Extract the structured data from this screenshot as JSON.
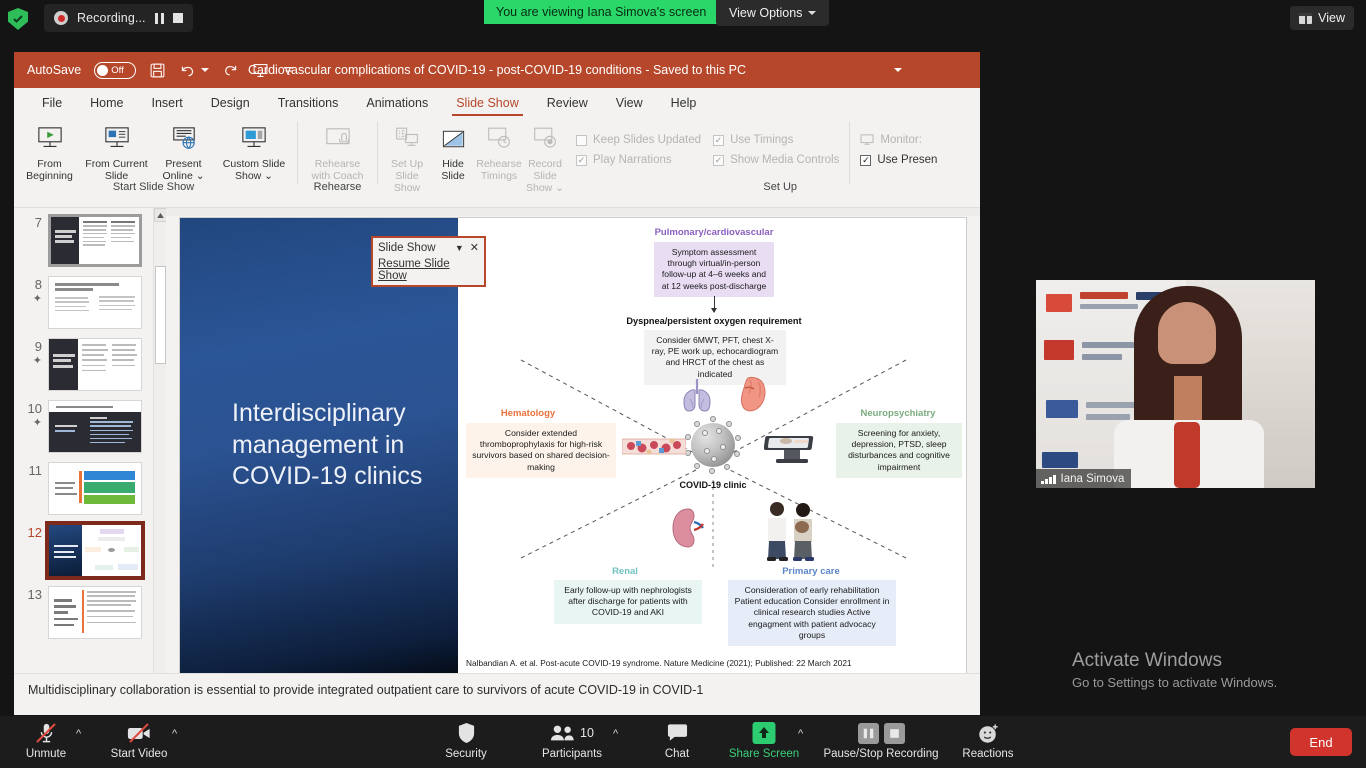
{
  "zoom_top": {
    "recording_label": "Recording...",
    "viewing_banner": "You are viewing Iana Simova's screen",
    "view_options": "View Options",
    "view_button": "View"
  },
  "powerpoint": {
    "autosave_label": "AutoSave",
    "autosave_state": "Off",
    "document_title": "Cardiovascular complications of COVID-19 - post-COVID-19 conditions  -  Saved to this PC",
    "quick_access": [
      "save-icon",
      "undo-icon",
      "redo-icon",
      "start-slideshow-icon",
      "more-icon"
    ],
    "tabs": [
      {
        "label": "File",
        "active": false
      },
      {
        "label": "Home",
        "active": false
      },
      {
        "label": "Insert",
        "active": false
      },
      {
        "label": "Design",
        "active": false
      },
      {
        "label": "Transitions",
        "active": false
      },
      {
        "label": "Animations",
        "active": false
      },
      {
        "label": "Slide Show",
        "active": true
      },
      {
        "label": "Review",
        "active": false
      },
      {
        "label": "View",
        "active": false
      },
      {
        "label": "Help",
        "active": false
      }
    ],
    "ribbon": {
      "groups": [
        {
          "label": "Start Slide Show",
          "buttons": [
            {
              "label": "From Beginning",
              "icon": "from-beginning-icon",
              "disabled": false
            },
            {
              "label": "From Current Slide",
              "icon": "from-current-slide-icon",
              "disabled": false
            },
            {
              "label": "Present Online ⌄",
              "icon": "present-online-icon",
              "disabled": false
            },
            {
              "label": "Custom Slide Show ⌄",
              "icon": "custom-slide-show-icon",
              "disabled": false
            }
          ]
        },
        {
          "label": "Rehearse",
          "buttons": [
            {
              "label": "Rehearse with Coach",
              "icon": "rehearse-with-coach-icon",
              "disabled": true
            }
          ]
        },
        {
          "label": "",
          "buttons": [
            {
              "label": "Set Up Slide Show",
              "icon": "set-up-slide-show-icon",
              "disabled": true
            },
            {
              "label": "Hide Slide",
              "icon": "hide-slide-icon",
              "disabled": false
            },
            {
              "label": "Rehearse Timings",
              "icon": "rehearse-timings-icon",
              "disabled": true
            },
            {
              "label": "Record Slide Show ⌄",
              "icon": "record-slide-show-icon",
              "disabled": true
            }
          ]
        },
        {
          "label": "Set Up",
          "checkboxes": [
            {
              "label": "Keep Slides Updated",
              "checked": false
            },
            {
              "label": "Use Timings",
              "checked": true
            },
            {
              "label": "Play Narrations",
              "checked": true
            },
            {
              "label": "Show Media Controls",
              "checked": true
            }
          ]
        },
        {
          "label": "",
          "checkboxes": [
            {
              "label": "Monitor:",
              "checked": null
            },
            {
              "label": "Use Presen",
              "checked": true
            }
          ]
        }
      ]
    },
    "slideshow_popup": {
      "title": "Slide Show",
      "menu_item": "Resume Slide Show"
    },
    "thumbnails": [
      {
        "number": "7",
        "starred": false,
        "selected": false,
        "style": "dark-split"
      },
      {
        "number": "8",
        "starred": true,
        "selected": false,
        "style": "light-two-col"
      },
      {
        "number": "9",
        "starred": true,
        "selected": false,
        "style": "dark-split"
      },
      {
        "number": "10",
        "starred": true,
        "selected": false,
        "style": "dark-lower"
      },
      {
        "number": "11",
        "starred": false,
        "selected": false,
        "style": "color-bars"
      },
      {
        "number": "12",
        "starred": false,
        "selected": true,
        "style": "current-diagram"
      },
      {
        "number": "13",
        "starred": false,
        "selected": false,
        "style": "light-two-col"
      }
    ],
    "notes_text": "Multidisciplinary collaboration is essential to provide integrated outpatient care to survivors of acute COVID-19 in COVID-1"
  },
  "slide": {
    "title": "Interdisciplinary management in COVID-19 clinics",
    "caption": "Nalbandian A. et al. Post-acute COVID-19 syndrome. Nature Medicine (2021); Published: 22 March 2021",
    "center_label": "COVID-19 clinic",
    "top_heading": "Pulmonary/cardiovascular",
    "top_box": "Symptom assessment through virtual/in-person follow-up at 4–6 weeks and at 12 weeks post-discharge",
    "mid_heading": "Dyspnea/persistent oxygen requirement",
    "mid_box": "Consider 6MWT, PFT, chest X-ray, PE work up, echocardiogram and HRCT of the chest as indicated",
    "sections": [
      {
        "name": "Hematology",
        "color": "#e8733a",
        "bg": "#fdf3ea",
        "text": "Consider extended thromboprophylaxis for high-risk survivors based on shared decision-making",
        "icon": "blood-vessel-icon"
      },
      {
        "name": "Neuropsychiatry",
        "color": "#7aab7f",
        "bg": "#e9f2e8",
        "text": "Screening for anxiety, depression, PTSD, sleep disturbances and cognitive impairment",
        "icon": "brain-scan-icon"
      },
      {
        "name": "Renal",
        "color": "#6fc3c0",
        "bg": "#e8f5f3",
        "text": "Early follow-up with nephrologists after discharge for patients with COVID-19 and AKI",
        "icon": "kidney-icon"
      },
      {
        "name": "Primary care",
        "color": "#5b86c9",
        "bg": "#e7edf8",
        "text": "Consideration of early rehabilitation Patient education Consider enrollment in clinical research studies Active engagment with patient advocacy groups",
        "icon": "patients-icon"
      }
    ],
    "organs": [
      "lungs-icon",
      "heart-icon"
    ]
  },
  "video": {
    "participant_name": "Iana Simova"
  },
  "watermark": {
    "line1": "Activate Windows",
    "line2": "Go to Settings to activate Windows."
  },
  "zoom_bottom": {
    "items": [
      {
        "label": "Unmute",
        "icon": "microphone-muted-icon",
        "caret": true,
        "green": false
      },
      {
        "label": "Start Video",
        "icon": "video-off-icon",
        "caret": true,
        "green": false
      },
      {
        "label": "Security",
        "icon": "shield-icon",
        "caret": false,
        "green": false
      },
      {
        "label": "Participants",
        "icon": "participants-icon",
        "caret": true,
        "green": false,
        "count": "10"
      },
      {
        "label": "Chat",
        "icon": "chat-icon",
        "caret": false,
        "green": false
      },
      {
        "label": "Share Screen",
        "icon": "share-screen-icon",
        "caret": true,
        "green": true
      },
      {
        "label": "Pause/Stop Recording",
        "icon": "pause-stop-recording-icon",
        "caret": false,
        "green": false
      },
      {
        "label": "Reactions",
        "icon": "reactions-icon",
        "caret": false,
        "green": false
      }
    ],
    "end_button": "End",
    "participant_count": "10"
  },
  "colors": {
    "ppt_accent": "#b7472a",
    "zoom_green": "#2ad86a",
    "end_red": "#d0342c"
  }
}
